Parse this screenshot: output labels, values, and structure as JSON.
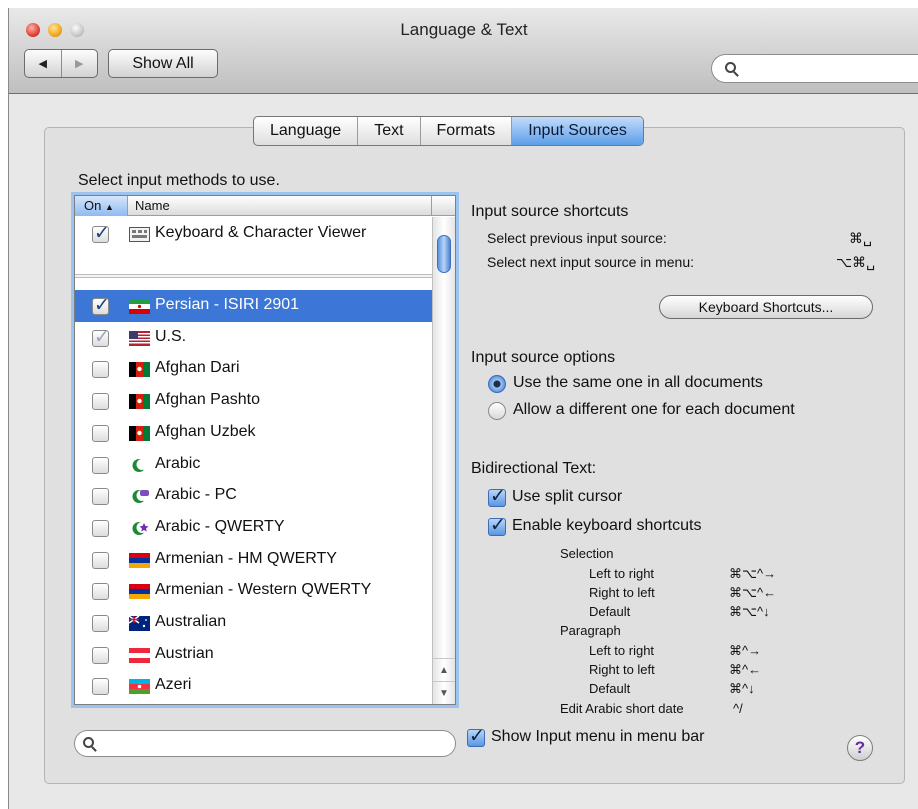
{
  "window": {
    "title": "Language & Text",
    "show_all_label": "Show All",
    "search_placeholder": ""
  },
  "tabs": [
    {
      "label": "Language",
      "active": false
    },
    {
      "label": "Text",
      "active": false
    },
    {
      "label": "Formats",
      "active": false
    },
    {
      "label": "Input Sources",
      "active": true
    }
  ],
  "input_methods": {
    "prompt": "Select input methods to use.",
    "col_on": "On",
    "col_name": "Name",
    "top_item": {
      "label": "Keyboard & Character Viewer",
      "checked": true
    },
    "items": [
      {
        "label": "Persian - ISIRI 2901",
        "checked": true,
        "selected": true,
        "flag": "flag-iran-icon"
      },
      {
        "label": "U.S.",
        "checked": true,
        "dimmed": true,
        "flag": "flag-us-icon"
      },
      {
        "label": "Afghan Dari",
        "checked": false,
        "flag": "flag-afghanistan-icon"
      },
      {
        "label": "Afghan Pashto",
        "checked": false,
        "flag": "flag-afghanistan-icon"
      },
      {
        "label": "Afghan Uzbek",
        "checked": false,
        "flag": "flag-afghanistan-icon"
      },
      {
        "label": "Arabic",
        "checked": false,
        "flag": "crescent-icon"
      },
      {
        "label": "Arabic - PC",
        "checked": false,
        "flag": "crescent-pc-icon"
      },
      {
        "label": "Arabic - QWERTY",
        "checked": false,
        "flag": "crescent-star-icon"
      },
      {
        "label": "Armenian - HM QWERTY",
        "checked": false,
        "flag": "flag-armenia-icon"
      },
      {
        "label": "Armenian - Western QWERTY",
        "checked": false,
        "flag": "flag-armenia-icon"
      },
      {
        "label": "Australian",
        "checked": false,
        "flag": "flag-australia-icon"
      },
      {
        "label": "Austrian",
        "checked": false,
        "flag": "flag-austria-icon"
      },
      {
        "label": "Azeri",
        "checked": false,
        "flag": "flag-azerbaijan-icon"
      }
    ],
    "search_placeholder": ""
  },
  "shortcuts": {
    "title": "Input source shortcuts",
    "prev_label": "Select previous input source:",
    "prev_keys": "⌘␣",
    "next_label": "Select next input source in menu:",
    "next_keys": "⌥⌘␣",
    "button_label": "Keyboard Shortcuts..."
  },
  "options": {
    "title": "Input source options",
    "same_label": "Use the same one in all documents",
    "different_label": "Allow a different one for each document",
    "selected": "same"
  },
  "bidi": {
    "title": "Bidirectional Text:",
    "split_cursor_label": "Use split cursor",
    "split_cursor_checked": true,
    "kbd_shortcuts_label": "Enable keyboard shortcuts",
    "kbd_shortcuts_checked": true,
    "selection_heading": "Selection",
    "selection": [
      {
        "label": "Left to right",
        "keys": "⌘⌥^→"
      },
      {
        "label": "Right to left",
        "keys": "⌘⌥^←"
      },
      {
        "label": "Default",
        "keys": "⌘⌥^↓"
      }
    ],
    "paragraph_heading": "Paragraph",
    "paragraph": [
      {
        "label": "Left to right",
        "keys": "⌘^→"
      },
      {
        "label": "Right to left",
        "keys": "⌘^←"
      },
      {
        "label": "Default",
        "keys": "⌘^↓"
      }
    ],
    "arabic_date_label": "Edit Arabic short date",
    "arabic_date_keys": "^/"
  },
  "footer": {
    "show_menu_label": "Show Input menu in menu bar",
    "show_menu_checked": true,
    "help_label": "?"
  },
  "colors": {
    "selection": "#3c77d7",
    "tab_active": "#5d9ee9",
    "panel": "#e0e0e0"
  }
}
